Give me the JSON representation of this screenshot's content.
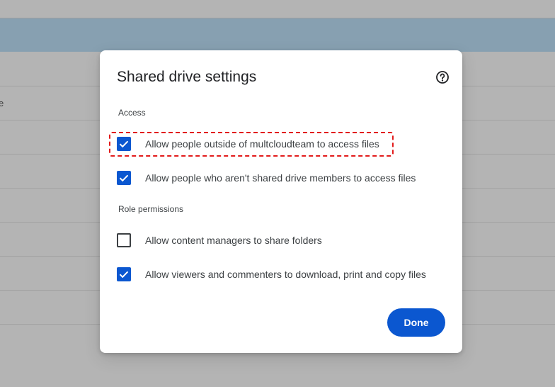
{
  "background": {
    "fragment_text": "e"
  },
  "dialog": {
    "title": "Shared drive settings",
    "help_icon": "help-circle-icon",
    "sections": [
      {
        "label": "Access",
        "options": [
          {
            "label": "Allow people outside of multcloudteam to access files",
            "checked": true,
            "highlighted": true
          },
          {
            "label": "Allow people who aren't shared drive members to access files",
            "checked": true
          }
        ]
      },
      {
        "label": "Role permissions",
        "options": [
          {
            "label": "Allow content managers to share folders",
            "checked": false
          },
          {
            "label": "Allow viewers and commenters to download, print and copy files",
            "checked": true
          }
        ]
      }
    ],
    "done_label": "Done"
  },
  "colors": {
    "accent": "#0b57d0",
    "highlight": "#e21b1b",
    "overlay": "#b4b4b4"
  }
}
